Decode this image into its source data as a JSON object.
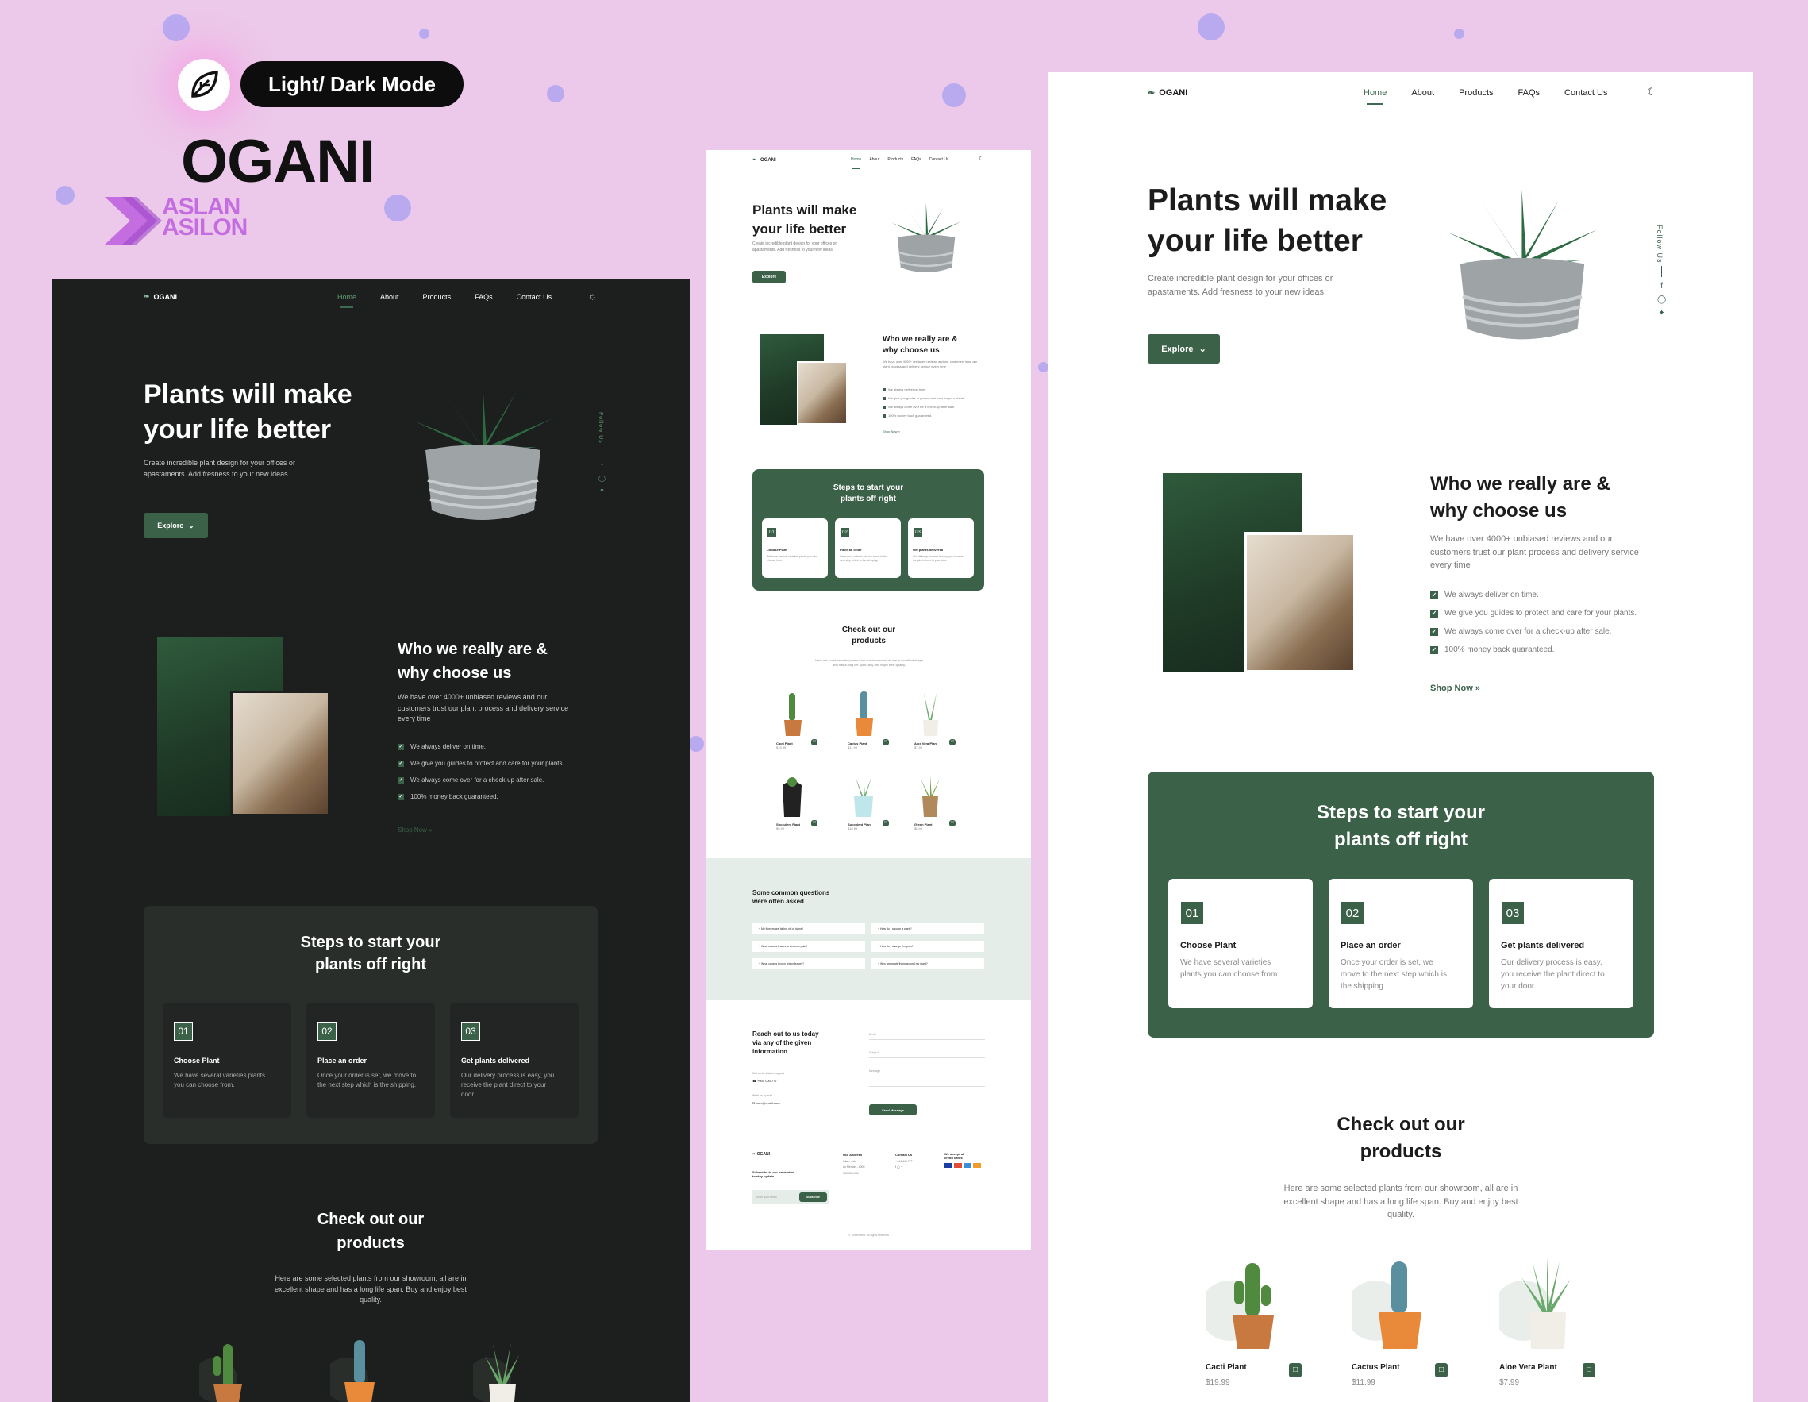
{
  "branding": {
    "mode_label": "Light/ Dark Mode",
    "title": "OGANI",
    "author_line1": "ASLAN",
    "author_line2": "ASILON"
  },
  "site": {
    "logo": "OGANI",
    "nav": [
      "Home",
      "About",
      "Products",
      "FAQs",
      "Contact Us"
    ],
    "hero_title_l1": "Plants will make",
    "hero_title_l2": "your life better",
    "hero_sub": "Create incredible plant design for your offices or apastaments. Add fresness to your new ideas.",
    "hero_btn": "Explore",
    "follow": "Follow Us",
    "about_title_l1": "Who we really are &",
    "about_title_l2": "why choose us",
    "about_text": "We have over 4000+ unbiased reviews and our customers trust our plant process and delivery service every time",
    "checks": [
      "We always deliver on time.",
      "We give you guides to protect and care for your plants.",
      "We always come over for a check-up after sale.",
      "100% money back guaranteed."
    ],
    "shop_now": "Shop Now",
    "steps_title_l1": "Steps to start your",
    "steps_title_l2": "plants off right",
    "steps": [
      {
        "num": "01",
        "title": "Choose Plant",
        "desc": "We have several varieties plants you can choose from."
      },
      {
        "num": "02",
        "title": "Place an order",
        "desc": "Once your order is set, we move to the next step which is the shipping."
      },
      {
        "num": "03",
        "title": "Get plants delivered",
        "desc": "Our delivery process is easy, you receive the plant direct to your door."
      }
    ],
    "products_title_l1": "Check out our",
    "products_title_l2": "products",
    "products_sub": "Here are some selected plants from our showroom, all are in excellent shape and has a long life span. Buy and enjoy best quality.",
    "products": [
      {
        "name": "Cacti Plant",
        "price": "$19.99"
      },
      {
        "name": "Cactus Plant",
        "price": "$11.99"
      },
      {
        "name": "Aloe Vera Plant",
        "price": "$7.99"
      },
      {
        "name": "Succulent Plant",
        "price": "$5.99"
      },
      {
        "name": "Succulent Plant",
        "price": "$10.99"
      },
      {
        "name": "Green Plant",
        "price": "$8.99"
      }
    ],
    "faq_title_l1": "Some common questions",
    "faq_title_l2": "were often asked",
    "faqs": [
      "My flowers are falling off or dying?",
      "How do I choose a plant?",
      "What causes leaves to become pale?",
      "How do I change the pots?",
      "What causes brown crispy leaves?",
      "Why are gnats flying around my plant?"
    ],
    "contact_title_l1": "Reach out to us today",
    "contact_title_l2": "via any of the given",
    "contact_title_l3": "information",
    "contact_call_label": "Call us for instant support",
    "contact_phone": "+000 000 777",
    "contact_mail_label": "Write us by mail",
    "contact_email": "user@email.com",
    "form_email": "Email",
    "form_subject": "Subject",
    "form_message": "Message",
    "send_btn": "Send Message",
    "footer_logo": "OGANI",
    "footer_newsletter_l1": "Subscribe to our newsletter",
    "footer_newsletter_l2": "to stay update",
    "footer_email_placeholder": "Enter your email",
    "footer_subscribe": "Subscribe",
    "footer_address_title": "Our Address",
    "footer_address_l1": "Islam - Isla",
    "footer_address_l2": "Lo Mentari - 4000",
    "footer_address_l3": "000-000-000",
    "footer_contact_title": "Contact Us",
    "footer_contact_l1": "+444 444 777",
    "footer_cards_title_l1": "We accept all",
    "footer_cards_title_l2": "credit cards",
    "copyright": "© GreenMind. All rights reserved"
  },
  "colors": {
    "accent": "#3b6149",
    "dark_bg": "#1d1f1e",
    "dark_card": "#2a2e2b",
    "background": "#ecc8ea"
  }
}
